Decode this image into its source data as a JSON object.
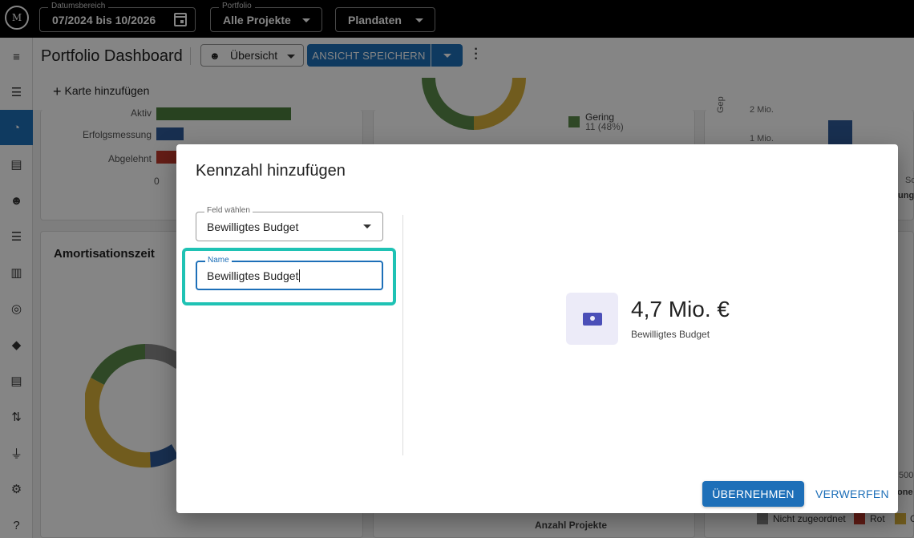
{
  "topbar": {
    "logo_text": "M",
    "date_range": {
      "label": "Datumsbereich",
      "value": "07/2024 bis 10/2026"
    },
    "portfolio": {
      "label": "Portfolio",
      "value": "Alle Projekte"
    },
    "data_type": {
      "value": "Plandaten"
    }
  },
  "sidebar": {
    "items": [
      {
        "icon": "menu-icon",
        "glyph": "≡"
      },
      {
        "icon": "people-list-icon",
        "glyph": "☰"
      },
      {
        "icon": "dashboard-icon",
        "glyph": "◔",
        "active": true
      },
      {
        "icon": "clipboard-icon",
        "glyph": "▤"
      },
      {
        "icon": "group-icon",
        "glyph": "☻"
      },
      {
        "icon": "list-icon",
        "glyph": "☰"
      },
      {
        "icon": "columns-icon",
        "glyph": "▥"
      },
      {
        "icon": "target-icon",
        "glyph": "◎"
      },
      {
        "icon": "directions-icon",
        "glyph": "◆"
      },
      {
        "icon": "document-icon",
        "glyph": "▤"
      },
      {
        "icon": "sort-icon",
        "glyph": "⇅"
      },
      {
        "icon": "plug-icon",
        "glyph": "⏚"
      },
      {
        "icon": "settings-icon",
        "glyph": "⚙"
      },
      {
        "icon": "help-icon",
        "glyph": "?"
      }
    ]
  },
  "header": {
    "title": "Portfolio Dashboard",
    "view_select": "Übersicht",
    "save_button": "ANSICHT SPEICHERN",
    "add_card": "Karte hinzufügen"
  },
  "background": {
    "status_bars": [
      "Aktiv",
      "Erfolgsmessung",
      "Abgelehnt"
    ],
    "axis_zero": "0",
    "amortisation_title": "Amortisationszeit",
    "legend_gering": "Gering",
    "legend_gering_value": "11 (48%)",
    "axis_2mio": "2 Mio.",
    "axis_1mio": "1 Mio.",
    "axis_ge": "Gep",
    "anzahl_projekte": "Anzahl Projekte",
    "legend_bottom": [
      "Nicht zugeordnet",
      "Rot",
      "G"
    ],
    "right_fragments": [
      "So",
      "lung",
      "500",
      "one"
    ]
  },
  "colors": {
    "primary": "#1d6fb8",
    "highlight": "#1fc2b4",
    "bar_green": "#4e7f3f",
    "bar_blue": "#2f5a9a",
    "bar_red": "#c0392b",
    "donut_gray": "#8a8a8a",
    "donut_yellow": "#d9b13a",
    "donut_green": "#5a8a4a",
    "donut_blue": "#2f5a9a"
  },
  "dialog": {
    "title": "Kennzahl hinzufügen",
    "field_select": {
      "label": "Feld wählen",
      "value": "Bewilligtes Budget"
    },
    "name_input": {
      "label": "Name",
      "value": "Bewilligtes Budget"
    },
    "kpi_preview": {
      "value": "4,7 Mio. €",
      "label": "Bewilligtes Budget",
      "icon": "money-bill-icon"
    },
    "apply_button": "ÜBERNEHMEN",
    "discard_button": "VERWERFEN"
  }
}
